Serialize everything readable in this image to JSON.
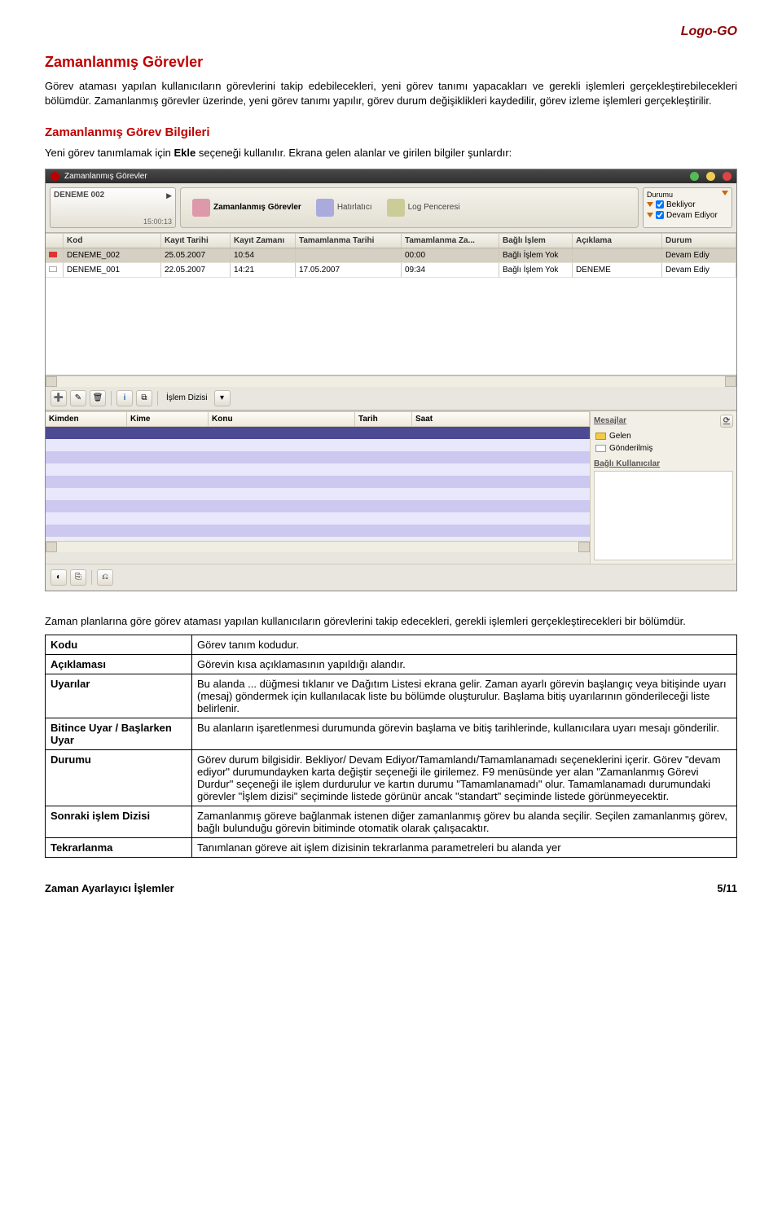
{
  "logo": "Logo-GO",
  "h1": "Zamanlanmış Görevler",
  "p1": "Görev ataması yapılan kullanıcıların görevlerini takip edebilecekleri, yeni görev tanımı yapacakları ve gerekli işlemleri gerçekleştirebilecekleri bölümdür. Zamanlanmış görevler üzerinde, yeni görev tanımı yapılır, görev durum değişiklikleri kaydedilir, görev izleme işlemleri gerçekleştirilir.",
  "h2": "Zamanlanmış Görev Bilgileri",
  "p2a": "Yeni görev tanımlamak için ",
  "p2b": "Ekle",
  "p2c": " seçeneği kullanılır. Ekrana gelen alanlar ve girilen bilgiler şunlardır:",
  "app": {
    "title": "Zamanlanmış Görevler",
    "card": {
      "label": "DENEME  002",
      "time": "15:00:13"
    },
    "tabs": {
      "t1": "Zamanlanmış Görevler",
      "t2": "Hatırlatıcı",
      "t3": "Log Penceresi"
    },
    "durumu": {
      "title": "Durumu",
      "opt1": "Bekliyor",
      "opt2": "Devam Ediyor"
    },
    "grid": {
      "headers": {
        "kod": "Kod",
        "kt": "Kayıt Tarihi",
        "kz": "Kayıt Zamanı",
        "tt": "Tamamlanma Tarihi",
        "tz": "Tamamlanma Za...",
        "bi": "Bağlı İşlem",
        "ac": "Açıklama",
        "du": "Durum"
      },
      "rows": [
        {
          "kod": "DENEME_002",
          "kt": "25.05.2007",
          "kz": "10:54",
          "tt": "",
          "tz": "00:00",
          "bi": "Bağlı İşlem Yok",
          "ac": "",
          "du": "Devam Ediy",
          "flag": "red"
        },
        {
          "kod": "DENEME_001",
          "kt": "22.05.2007",
          "kz": "14:21",
          "tt": "17.05.2007",
          "tz": "09:34",
          "bi": "Bağlı İşlem Yok",
          "ac": "DENEME",
          "du": "Devam Ediy",
          "flag": "wh"
        }
      ]
    },
    "iconbar": {
      "islem": "İşlem Dizisi"
    },
    "subgrid": {
      "kimden": "Kimden",
      "kime": "Kime",
      "konu": "Konu",
      "tarih": "Tarih",
      "saat": "Saat"
    },
    "msgs": {
      "head": "Mesajlar",
      "gelen": "Gelen",
      "gond": "Gönderilmiş",
      "bagli": "Bağlı Kullanıcılar"
    }
  },
  "p3": "Zaman planlarına göre görev ataması yapılan kullanıcıların  görevlerini takip edecekleri, gerekli işlemleri gerçekleştirecekleri bir bölümdür.",
  "table": {
    "rows": [
      {
        "lab": "Kodu",
        "val": "Görev tanım kodudur."
      },
      {
        "lab": "Açıklaması",
        "val": "Görevin kısa açıklamasının yapıldığı alandır."
      },
      {
        "lab": "Uyarılar",
        "val": "Bu alanda ... düğmesi tıklanır ve Dağıtım Listesi ekrana gelir. Zaman ayarlı görevin başlangıç veya bitişinde uyarı (mesaj) göndermek için kullanılacak liste bu bölümde oluşturulur. Başlama bitiş uyarılarının gönderileceği liste belirlenir."
      },
      {
        "lab": "Bitince Uyar / Başlarken Uyar",
        "val": "Bu alanların işaretlenmesi durumunda görevin başlama ve bitiş tarihlerinde, kullanıcılara uyarı mesajı gönderilir."
      },
      {
        "lab": "Durumu",
        "val": "Görev durum bilgisidir. Bekliyor/ Devam Ediyor/Tamamlandı/Tamamlanamadı seçeneklerini içerir. Görev \"devam ediyor\" durumundayken karta değiştir seçeneği ile girilemez. F9 menüsünde yer alan \"Zamanlanmış Görevi Durdur\" seçeneği ile işlem durdurulur ve kartın durumu \"Tamamlanamadı\" olur. Tamamlanamadı durumundaki görevler \"İşlem dizisi\" seçiminde listede görünür ancak \"standart\" seçiminde listede görünmeyecektir."
      },
      {
        "lab": "Sonraki işlem Dizisi",
        "val": "Zamanlanmış göreve bağlanmak istenen diğer zamanlanmış görev bu alanda seçilir. Seçilen zamanlanmış görev, bağlı bulunduğu görevin bitiminde otomatik olarak çalışacaktır."
      },
      {
        "lab": "Tekrarlanma",
        "val": "Tanımlanan göreve ait işlem dizisinin tekrarlanma parametreleri bu alanda yer"
      }
    ]
  },
  "footer": {
    "left": "Zaman Ayarlayıcı İşlemler",
    "right": "5/11"
  }
}
